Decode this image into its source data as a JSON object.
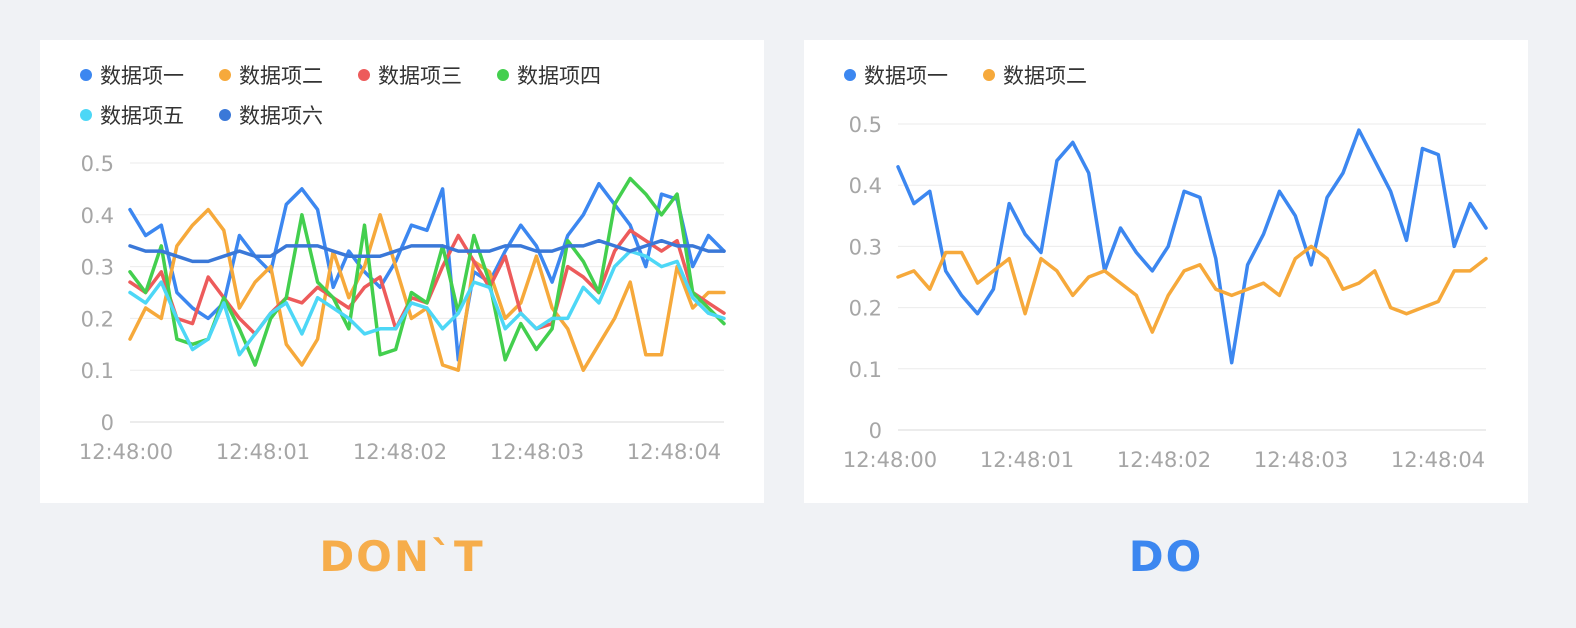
{
  "chart_data": [
    {
      "type": "line",
      "x": [
        "12:48:00",
        "12:48:01",
        "12:48:02",
        "12:48:03",
        "12:48:04"
      ],
      "ylim": [
        0,
        0.5
      ],
      "yticks": [
        "0",
        "0.1",
        "0.2",
        "0.3",
        "0.4",
        "0.5"
      ],
      "grid": true,
      "legend_position": "top-left",
      "series": [
        {
          "name": "数据项一",
          "color": "#3C87F0",
          "values": [
            0.41,
            0.36,
            0.38,
            0.25,
            0.22,
            0.2,
            0.23,
            0.36,
            0.32,
            0.29,
            0.42,
            0.45,
            0.41,
            0.26,
            0.33,
            0.29,
            0.26,
            0.31,
            0.38,
            0.37,
            0.45,
            0.12,
            0.29,
            0.27,
            0.33,
            0.38,
            0.34,
            0.27,
            0.36,
            0.4,
            0.46,
            0.42,
            0.38,
            0.3,
            0.44,
            0.43,
            0.3,
            0.36,
            0.33
          ]
        },
        {
          "name": "数据项二",
          "color": "#F6A93B",
          "values": [
            0.16,
            0.22,
            0.2,
            0.34,
            0.38,
            0.41,
            0.37,
            0.22,
            0.27,
            0.3,
            0.15,
            0.11,
            0.16,
            0.33,
            0.24,
            0.3,
            0.4,
            0.3,
            0.2,
            0.22,
            0.11,
            0.1,
            0.31,
            0.29,
            0.2,
            0.23,
            0.32,
            0.22,
            0.18,
            0.1,
            0.15,
            0.2,
            0.27,
            0.13,
            0.13,
            0.3,
            0.22,
            0.25,
            0.25
          ]
        },
        {
          "name": "数据项三",
          "color": "#ED5B5B",
          "values": [
            0.27,
            0.25,
            0.29,
            0.2,
            0.19,
            0.28,
            0.24,
            0.2,
            0.17,
            0.21,
            0.24,
            0.23,
            0.26,
            0.24,
            0.22,
            0.26,
            0.28,
            0.18,
            0.24,
            0.23,
            0.3,
            0.36,
            0.31,
            0.26,
            0.32,
            0.21,
            0.18,
            0.19,
            0.3,
            0.28,
            0.25,
            0.33,
            0.37,
            0.35,
            0.33,
            0.35,
            0.25,
            0.23,
            0.21
          ]
        },
        {
          "name": "数据项四",
          "color": "#43CF4E",
          "values": [
            0.29,
            0.25,
            0.34,
            0.16,
            0.15,
            0.16,
            0.24,
            0.18,
            0.11,
            0.2,
            0.24,
            0.4,
            0.27,
            0.24,
            0.18,
            0.38,
            0.13,
            0.14,
            0.25,
            0.23,
            0.34,
            0.21,
            0.36,
            0.27,
            0.12,
            0.19,
            0.14,
            0.18,
            0.35,
            0.31,
            0.25,
            0.42,
            0.47,
            0.44,
            0.4,
            0.44,
            0.25,
            0.22,
            0.19
          ]
        },
        {
          "name": "数据项五",
          "color": "#4DD7F6",
          "values": [
            0.25,
            0.23,
            0.27,
            0.2,
            0.14,
            0.16,
            0.23,
            0.13,
            0.17,
            0.21,
            0.23,
            0.17,
            0.24,
            0.22,
            0.2,
            0.17,
            0.18,
            0.18,
            0.23,
            0.22,
            0.18,
            0.21,
            0.27,
            0.26,
            0.18,
            0.21,
            0.18,
            0.2,
            0.2,
            0.26,
            0.23,
            0.3,
            0.33,
            0.32,
            0.3,
            0.31,
            0.24,
            0.21,
            0.2
          ]
        },
        {
          "name": "数据项六",
          "color": "#3A78D8",
          "values": [
            0.34,
            0.33,
            0.33,
            0.32,
            0.31,
            0.31,
            0.32,
            0.33,
            0.32,
            0.32,
            0.34,
            0.34,
            0.34,
            0.33,
            0.32,
            0.32,
            0.32,
            0.33,
            0.34,
            0.34,
            0.34,
            0.33,
            0.33,
            0.33,
            0.34,
            0.34,
            0.33,
            0.33,
            0.34,
            0.34,
            0.35,
            0.34,
            0.33,
            0.34,
            0.35,
            0.34,
            0.34,
            0.33,
            0.33
          ]
        }
      ]
    },
    {
      "type": "line",
      "x": [
        "12:48:00",
        "12:48:01",
        "12:48:02",
        "12:48:03",
        "12:48:04"
      ],
      "ylim": [
        0,
        0.5
      ],
      "yticks": [
        "0",
        "0.1",
        "0.2",
        "0.3",
        "0.4",
        "0.5"
      ],
      "grid": true,
      "legend_position": "top-left",
      "series": [
        {
          "name": "数据项一",
          "color": "#3C87F0",
          "values": [
            0.43,
            0.37,
            0.39,
            0.26,
            0.22,
            0.19,
            0.23,
            0.37,
            0.32,
            0.29,
            0.44,
            0.47,
            0.42,
            0.26,
            0.33,
            0.29,
            0.26,
            0.3,
            0.39,
            0.38,
            0.28,
            0.11,
            0.27,
            0.32,
            0.39,
            0.35,
            0.27,
            0.38,
            0.42,
            0.49,
            0.44,
            0.39,
            0.31,
            0.46,
            0.45,
            0.3,
            0.37,
            0.33
          ]
        },
        {
          "name": "数据项二",
          "color": "#F6A93B",
          "values": [
            0.25,
            0.26,
            0.23,
            0.29,
            0.29,
            0.24,
            0.26,
            0.28,
            0.19,
            0.28,
            0.26,
            0.22,
            0.25,
            0.26,
            0.24,
            0.22,
            0.16,
            0.22,
            0.26,
            0.27,
            0.23,
            0.22,
            0.23,
            0.24,
            0.22,
            0.28,
            0.3,
            0.28,
            0.23,
            0.24,
            0.26,
            0.2,
            0.19,
            0.2,
            0.21,
            0.26,
            0.26,
            0.28
          ]
        }
      ]
    }
  ],
  "captions": {
    "dont": {
      "text": "DON`T",
      "color": "#F6AD4B"
    },
    "do": {
      "text": "DO",
      "color": "#3C87F0"
    }
  },
  "colors": {
    "background": "#F0F2F5",
    "card": "#FFFFFF",
    "grid": "#EBEBEB",
    "axis": "#D9D9D9",
    "tick_text": "#A6A6A6"
  }
}
